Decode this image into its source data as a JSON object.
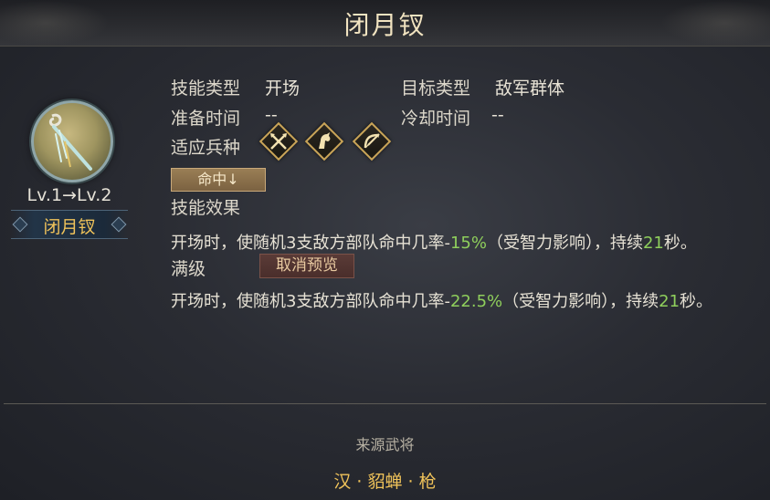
{
  "header": {
    "title": "闭月钗"
  },
  "skill": {
    "level_text": "Lv.1→Lv.2",
    "name": "闭月钗",
    "icon": "hairpin-icon"
  },
  "info": {
    "skill_type_label": "技能类型",
    "skill_type_value": "开场",
    "target_type_label": "目标类型",
    "target_type_value": "敌军群体",
    "prep_time_label": "准备时间",
    "prep_time_value": "--",
    "cooldown_label": "冷却时间",
    "cooldown_value": "--",
    "troops_label": "适应兵种",
    "troop_icons": [
      "crossed-spears-icon",
      "horse-icon",
      "bow-icon"
    ]
  },
  "effect_tag": "命中↓",
  "effect": {
    "label": "技能效果",
    "prefix": "开场时，使随机3支敌方部队命中几率-",
    "pct": "15%",
    "mid": "（受智力影响），持续",
    "dur": "21",
    "suffix": "秒。"
  },
  "max": {
    "label": "满级",
    "cancel_label": "取消预览",
    "prefix": "开场时，使随机3支敌方部队命中几率-",
    "pct": "22.5%",
    "mid": "（受智力影响），持续",
    "dur": "21",
    "suffix": "秒。"
  },
  "source": {
    "label": "来源武将",
    "value": "汉 · 貂蝉 · 枪"
  },
  "colors": {
    "gold": "#f0c35a",
    "highlight_green": "#8fcf5c"
  }
}
